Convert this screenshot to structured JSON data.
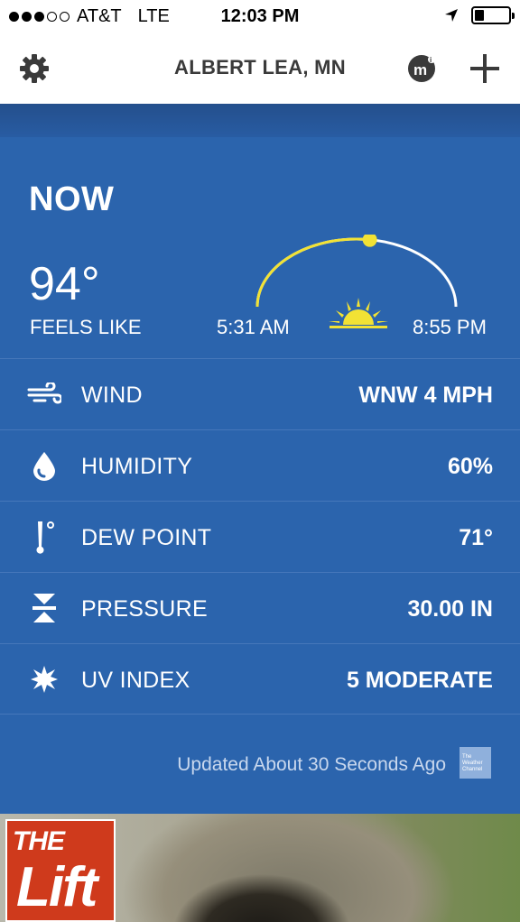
{
  "status_bar": {
    "carrier": "AT&T",
    "network": "LTE",
    "time": "12:03 PM",
    "signal_bars_filled": 3,
    "signal_bars_total": 5
  },
  "nav": {
    "title": "ALBERT LEA, MN",
    "settings_icon": "gear-icon",
    "mi_icon": "mi-icon",
    "add_icon": "plus-icon"
  },
  "now": {
    "heading": "NOW",
    "temperature": "94°",
    "feels_like_label": "FEELS LIKE",
    "sunrise": "5:31 AM",
    "sunset": "8:55 PM",
    "daylight_progress": 0.55
  },
  "conditions": [
    {
      "icon": "wind-icon",
      "label": "WIND",
      "value": "WNW 4 MPH"
    },
    {
      "icon": "humidity-drop-icon",
      "label": "HUMIDITY",
      "value": "60%"
    },
    {
      "icon": "thermometer-icon",
      "label": "DEW POINT",
      "value": "71°"
    },
    {
      "icon": "pressure-icon",
      "label": "PRESSURE",
      "value": "30.00 IN"
    },
    {
      "icon": "uv-sun-icon",
      "label": "UV INDEX",
      "value": "5 MODERATE"
    }
  ],
  "footer": {
    "updated_text": "Updated About 30 Seconds Ago",
    "provider_logo": "The Weather Channel"
  },
  "banner": {
    "badge_top": "THE",
    "badge_word": "Lift"
  },
  "colors": {
    "panel_blue": "#2b64ad",
    "arc_yellow": "#f2e234",
    "badge_red": "#cf3a1c"
  }
}
